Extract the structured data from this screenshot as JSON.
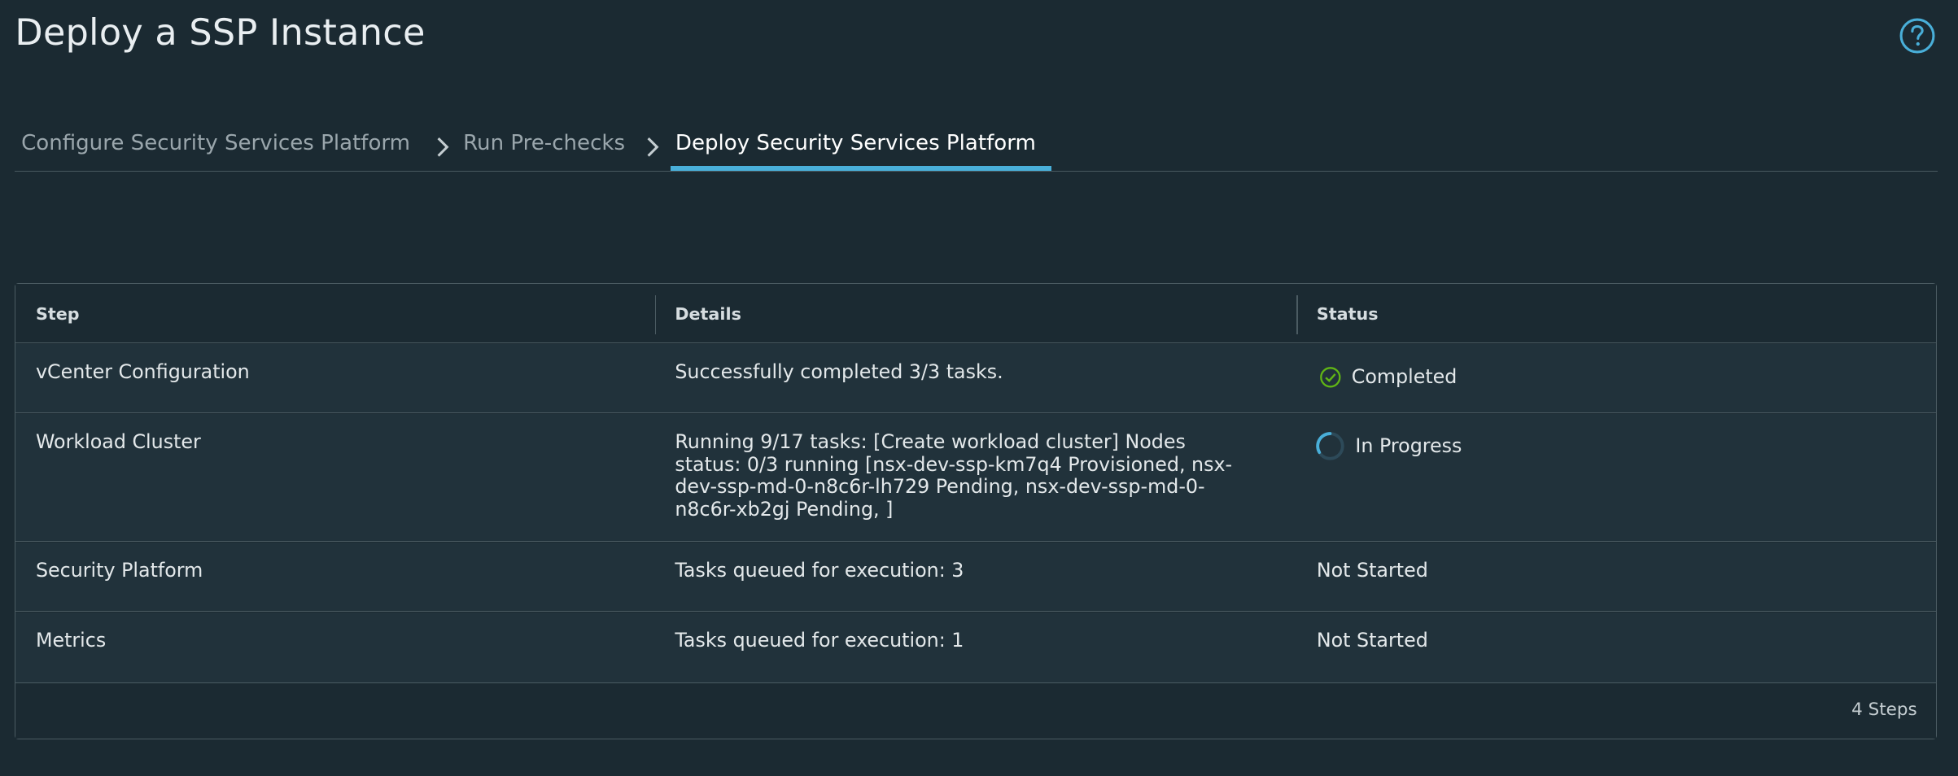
{
  "page": {
    "title": "Deploy a SSP Instance",
    "help_icon": "help-circle-icon"
  },
  "wizard": {
    "steps": [
      {
        "label": "Configure Security Services Platform"
      },
      {
        "label": "Run Pre-checks"
      },
      {
        "label": "Deploy Security Services Platform"
      }
    ],
    "current_step": "Deploy Security Services Platform",
    "accent_color": "#49afd9"
  },
  "grid": {
    "columns": [
      "Step",
      "Details",
      "Status"
    ],
    "rows": [
      {
        "step": "vCenter Configuration",
        "details": "Successfully completed 3/3 tasks.",
        "status": "Completed",
        "status_icon": "success-check-circle-icon"
      },
      {
        "step": "Workload Cluster",
        "details_lines": [
          "Running 9/17 tasks: [Create workload cluster] Nodes",
          "status: 0/3 running [nsx-dev-ssp-km7q4 Provisioned, nsx-",
          "dev-ssp-md-0-n8c6r-lh729 Pending, nsx-dev-ssp-md-0-",
          "n8c6r-xb2gj Pending, ]"
        ],
        "status": "In Progress",
        "status_icon": "spinner-icon"
      },
      {
        "step": "Security Platform",
        "details": "Tasks queued for execution: 3",
        "status": "Not Started"
      },
      {
        "step": "Metrics",
        "details": "Tasks queued for execution: 1",
        "status": "Not Started"
      }
    ],
    "footer": "4 Steps"
  },
  "colors": {
    "success": "#60b515",
    "spinner": "#49afd9"
  }
}
